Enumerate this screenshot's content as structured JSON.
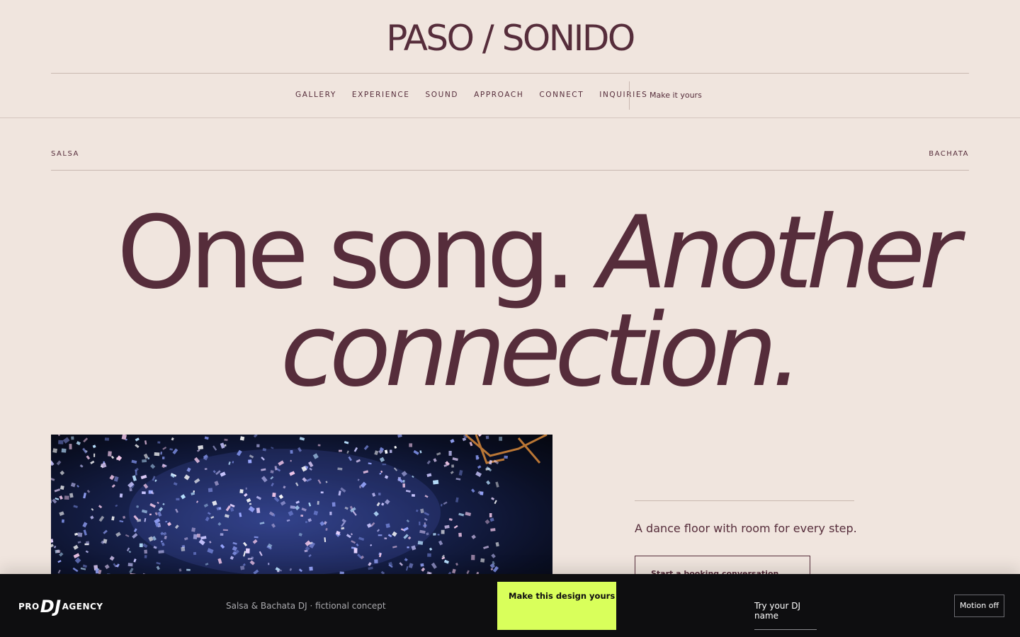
{
  "header": {
    "brand": "PASO / SONIDO",
    "nav": [
      "GALLERY",
      "EXPERIENCE",
      "SOUND",
      "APPROACH",
      "CONNECT",
      "INQUIRIES"
    ],
    "cta": "Make it yours"
  },
  "tags": {
    "left": "SALSA",
    "right": "BACHATA"
  },
  "hero": {
    "line1_roman": "One song.",
    "line1_italic": "Another",
    "line2_italic": "connection."
  },
  "feature": {
    "description": "A dance floor with room for every step.",
    "button": "Start a booking conversation"
  },
  "bottom_bar": {
    "logo_pro": "PRO",
    "logo_dj": "DJ",
    "logo_agency": "AGENCY",
    "meta": "Salsa & Bachata DJ · fictional concept",
    "cta": "Make this design yours",
    "try_link": "Try your DJ name",
    "motion_toggle": "Motion off"
  },
  "colors": {
    "background": "#f0e5de",
    "accent": "#562d3b",
    "bar": "#0e0e10",
    "cta_highlight": "#d9ff5b"
  }
}
